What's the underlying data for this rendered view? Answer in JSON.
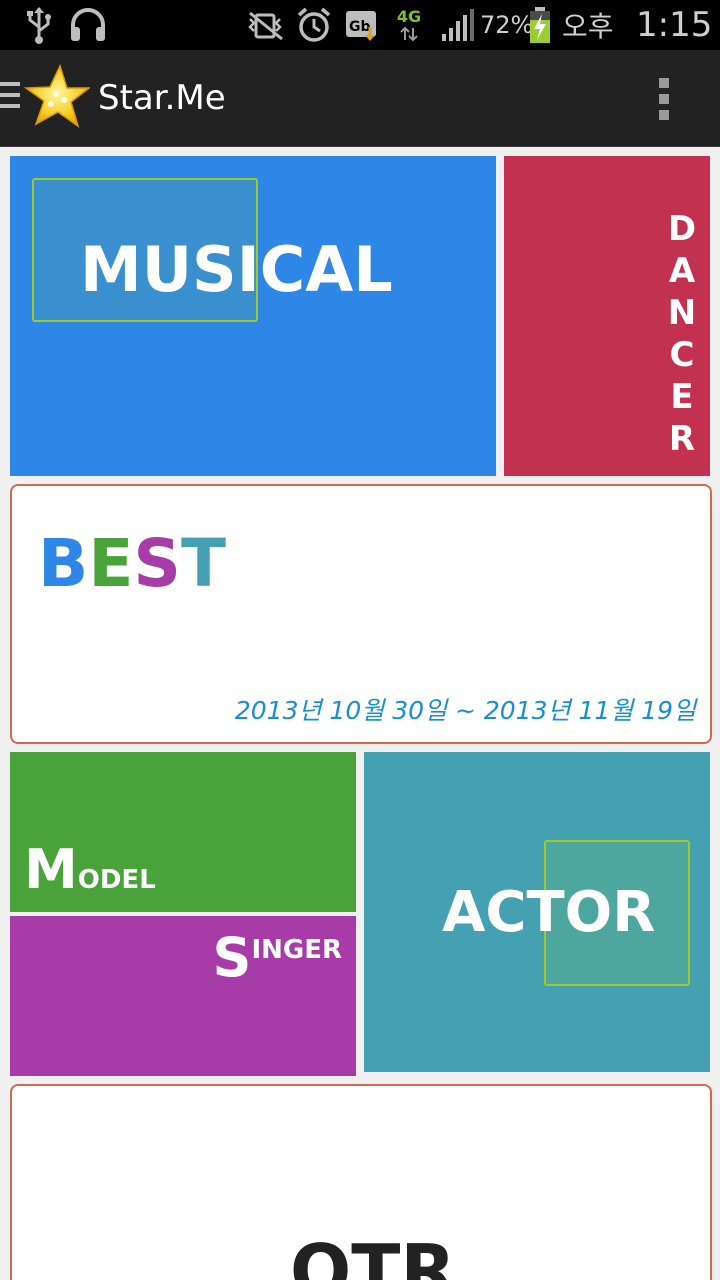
{
  "status_bar": {
    "battery": "72%",
    "network": "4G",
    "ampm": "오후",
    "time": "1:15",
    "icons": [
      "usb-icon",
      "headphones-icon",
      "no-vibrate-icon",
      "alarm-icon",
      "download-icon",
      "network-4g-icon",
      "signal-icon",
      "battery-charging-icon"
    ]
  },
  "app_bar": {
    "title": "Star.Me",
    "logo": "star-logo",
    "menu_icon": "hamburger-icon",
    "overflow_icon": "overflow-menu-icon"
  },
  "tiles": {
    "musical": {
      "label": "MUSICAL",
      "color": "#2e87e6"
    },
    "dancer": {
      "letters": [
        "D",
        "A",
        "N",
        "C",
        "E",
        "R"
      ],
      "color": "#c33150"
    },
    "best": {
      "letters": [
        {
          "char": "B",
          "color": "#2e87e6"
        },
        {
          "char": "E",
          "color": "#4aa23a"
        },
        {
          "char": "S",
          "color": "#a73ca8"
        },
        {
          "char": "T",
          "color": "#45a0b1"
        }
      ],
      "dates": "2013년 10월 30일 ~ 2013년 11월 19일",
      "border_color": "#d36a4e"
    },
    "model": {
      "initial": "M",
      "rest": "ODEL",
      "color": "#4aa23a"
    },
    "singer": {
      "initial": "S",
      "rest": "INGER",
      "color": "#a73ca8"
    },
    "actor": {
      "label": "ACTOR",
      "color": "#45a0b1"
    },
    "otr": {
      "label": "OTR"
    }
  }
}
